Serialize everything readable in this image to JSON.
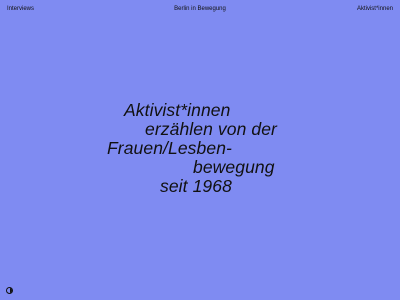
{
  "nav": {
    "left_label": "Interviews",
    "center_label": "Berlin in Bewegung",
    "right_label": "Aktivist*innen"
  },
  "hero": {
    "lines": [
      "Aktivist*innen",
      "erzählen von der",
      "Frauen/Lesben-",
      "bewegung",
      "seit 1968"
    ]
  },
  "footer": {
    "theme_icon": "contrast-toggle-icon"
  },
  "colors": {
    "background": "#7f8bf2",
    "text": "#111111"
  }
}
